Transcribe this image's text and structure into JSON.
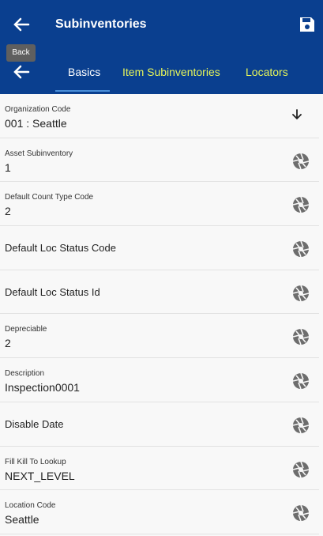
{
  "appbar": {
    "title": "Subinventories"
  },
  "tooltip": {
    "text": "Back"
  },
  "tabs": [
    {
      "label": "Basics"
    },
    {
      "label": "Item Subinventories"
    },
    {
      "label": "Locators"
    }
  ],
  "fields": {
    "organization_code": {
      "label": "Organization Code",
      "value": "001 : Seattle"
    },
    "asset_subinventory": {
      "label": "Asset Subinventory",
      "value": "1"
    },
    "default_count_type_code": {
      "label": "Default Count Type Code",
      "value": "2"
    },
    "default_loc_status_code": {
      "label": "Default Loc Status Code"
    },
    "default_loc_status_id": {
      "label": "Default Loc Status Id"
    },
    "depreciable": {
      "label": "Depreciable",
      "value": "2"
    },
    "description": {
      "label": "Description",
      "value": "Inspection0001"
    },
    "disable_date": {
      "label": "Disable Date"
    },
    "fill_kill_to_lookup": {
      "label": "Fill Kill To Lookup",
      "value": "NEXT_LEVEL"
    },
    "location_code": {
      "label": "Location Code",
      "value": "Seattle"
    }
  },
  "colors": {
    "header": "#0a3f8f",
    "tab_active": "#ffffff",
    "tab_inactive": "#e5f45a"
  },
  "icons": {
    "back": "arrow-left-icon",
    "save": "save-icon",
    "field_action": "aperture-icon",
    "dropdown": "arrow-down-icon"
  }
}
